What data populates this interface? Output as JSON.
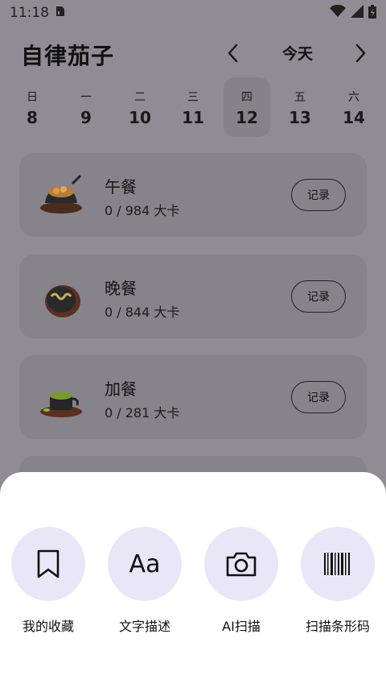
{
  "status_bar": {
    "time": "11:18"
  },
  "header": {
    "title": "自律茄子",
    "date_label": "今天"
  },
  "week": [
    {
      "name": "日",
      "num": "8",
      "selected": false
    },
    {
      "name": "一",
      "num": "9",
      "selected": false
    },
    {
      "name": "二",
      "num": "10",
      "selected": false
    },
    {
      "name": "三",
      "num": "11",
      "selected": false
    },
    {
      "name": "四",
      "num": "12",
      "selected": true
    },
    {
      "name": "五",
      "num": "13",
      "selected": false
    },
    {
      "name": "六",
      "num": "14",
      "selected": false
    }
  ],
  "meals": [
    {
      "name": "午餐",
      "calories": "0 / 984 大卡",
      "button": "记录",
      "icon": "lunch-dish-icon"
    },
    {
      "name": "晚餐",
      "calories": "0 / 844 大卡",
      "button": "记录",
      "icon": "dinner-dish-icon"
    },
    {
      "name": "加餐",
      "calories": "0 / 281 大卡",
      "button": "记录",
      "icon": "snack-dish-icon"
    }
  ],
  "sheet": {
    "actions": [
      {
        "label": "我的收藏",
        "icon": "bookmark-icon"
      },
      {
        "label": "文字描述",
        "icon": "text-aa-icon",
        "glyph": "Aa"
      },
      {
        "label": "AI扫描",
        "icon": "camera-icon"
      },
      {
        "label": "扫描条形码",
        "icon": "barcode-icon"
      }
    ]
  },
  "colors": {
    "sheet_icon_bg": "#e9e6f8",
    "overlay": "#8f8c93"
  }
}
